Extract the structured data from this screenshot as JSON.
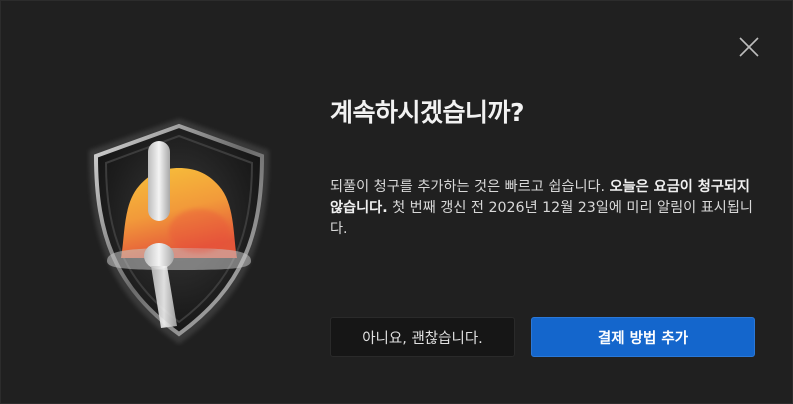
{
  "dialog": {
    "title": "계속하시겠습니까?",
    "body_part1": "되풀이 청구를 추가하는 것은 빠르고 쉽습니다. ",
    "body_bold": "오늘은 요금이 청구되지 않습니다.",
    "body_part2": " 첫 번째 갱신 전 2026년 12월 23일에 미리 알림이 표시됩니다.",
    "secondary_button": "아니요, 괜찮습니다.",
    "primary_button": "결제 방법 추가"
  },
  "icons": {
    "close": "close-icon",
    "illustration": "shield-bell-icon"
  },
  "colors": {
    "background": "#202020",
    "primary": "#1466cc",
    "bell_top": "#f5b92a",
    "bell_bottom": "#e8653a"
  }
}
